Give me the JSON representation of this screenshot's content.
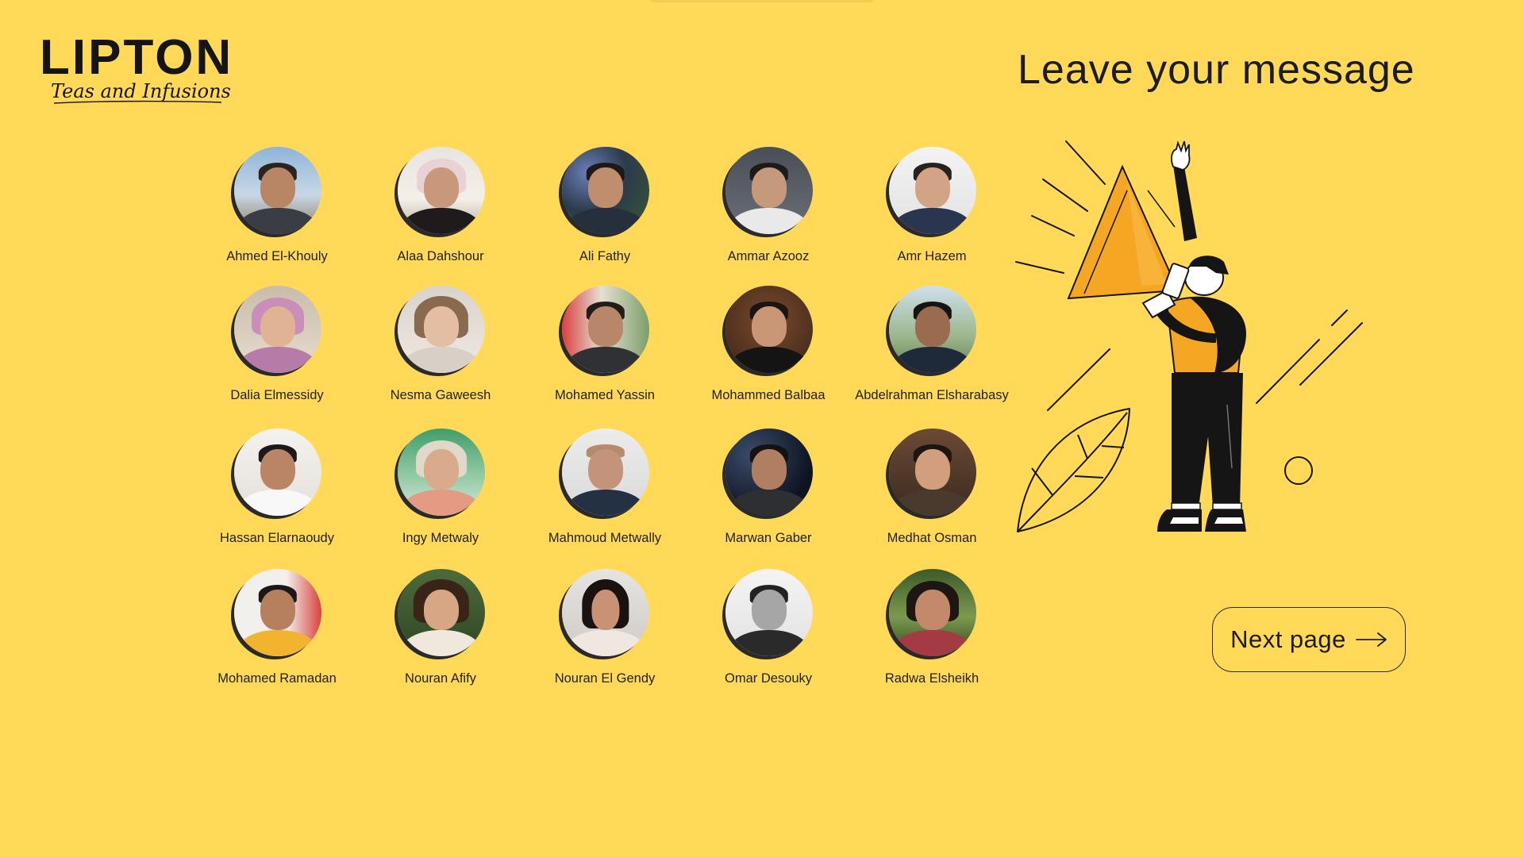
{
  "brand": {
    "logo_word": "LIPTON",
    "logo_tagline": "Teas and Infusions"
  },
  "heading": "Leave your message",
  "next_button": {
    "label": "Next page",
    "icon": "arrow-right-icon"
  },
  "colors": {
    "background": "#FFD957",
    "accent": "#F5A623",
    "ink": "#151515"
  },
  "people": [
    {
      "name": "Ahmed El-Khouly"
    },
    {
      "name": "Alaa Dahshour"
    },
    {
      "name": "Ali Fathy"
    },
    {
      "name": "Ammar Azooz"
    },
    {
      "name": "Amr Hazem"
    },
    {
      "name": "Dalia Elmessidy"
    },
    {
      "name": "Nesma Gaweesh"
    },
    {
      "name": "Mohamed Yassin"
    },
    {
      "name": "Mohammed Balbaa"
    },
    {
      "name": "Abdelrahman Elsharabasy"
    },
    {
      "name": "Hassan Elarnaoudy"
    },
    {
      "name": "Ingy Metwaly"
    },
    {
      "name": "Mahmoud Metwally"
    },
    {
      "name": "Marwan Gaber"
    },
    {
      "name": "Medhat Osman"
    },
    {
      "name": "Mohamed Ramadan"
    },
    {
      "name": "Nouran Afify"
    },
    {
      "name": "Nouran El Gendy"
    },
    {
      "name": "Omar Desouky"
    },
    {
      "name": "Radwa Elsheikh"
    }
  ]
}
